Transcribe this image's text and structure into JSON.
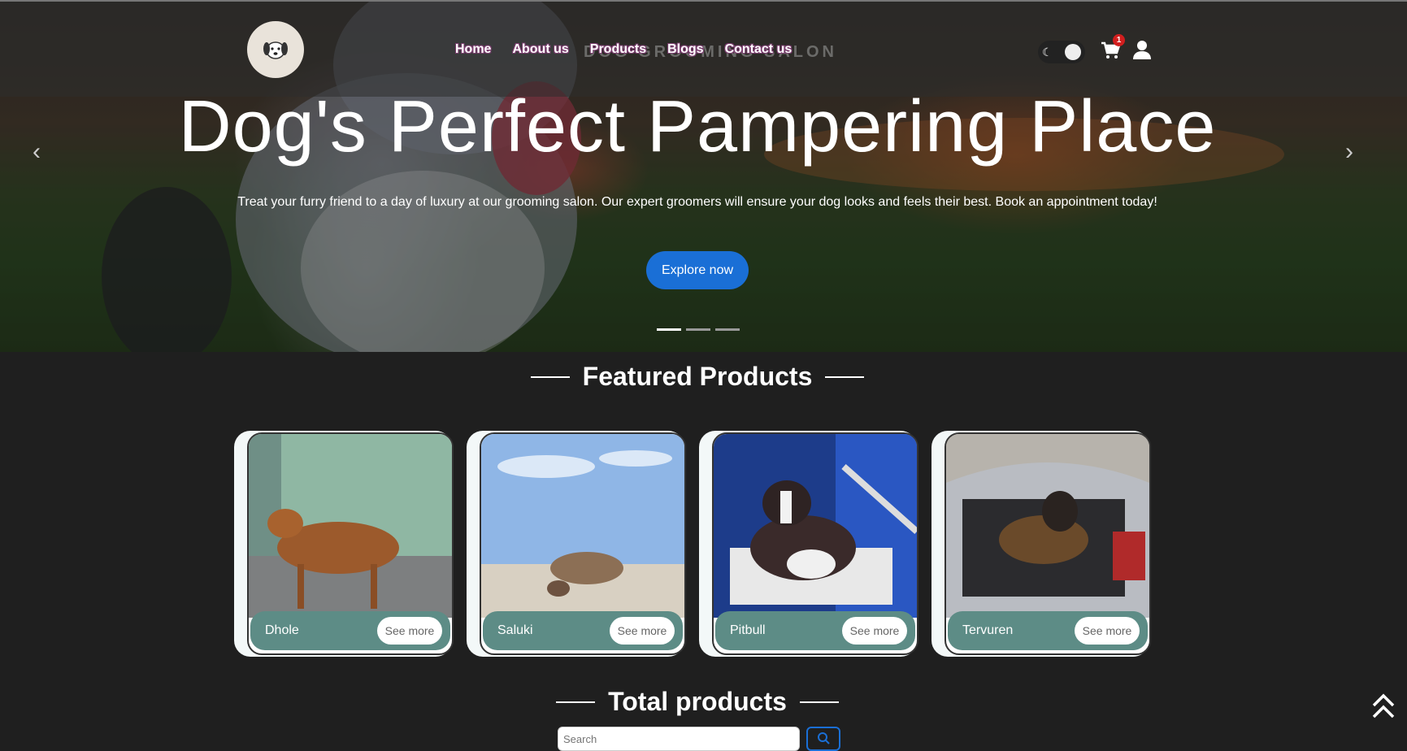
{
  "nav": {
    "items": [
      "Home",
      "About us",
      "Products",
      "Blogs",
      "Contact us"
    ],
    "watermark": "DOG GROOMING SALON",
    "cart_count": "1"
  },
  "hero": {
    "title": "Dog's Perfect Pampering Place",
    "subtitle": "Treat your furry friend to a day of luxury at our grooming salon. Our expert groomers will ensure your dog looks and feels their best. Book an appointment today!",
    "cta": "Explore now",
    "slides": 3,
    "active_slide": 1
  },
  "featured": {
    "title": "Featured Products",
    "products": [
      {
        "name": "Dhole",
        "button": "See more"
      },
      {
        "name": "Saluki",
        "button": "See more"
      },
      {
        "name": "Pitbull",
        "button": "See more"
      },
      {
        "name": "Tervuren",
        "button": "See more"
      }
    ]
  },
  "total": {
    "title": "Total products",
    "search_placeholder": "Search"
  },
  "colors": {
    "accent": "#1a6fd6",
    "card_footer": "#5d8c86",
    "badge": "#d21e1e",
    "background": "#1f1f1f"
  },
  "icons": [
    "dog-logo-icon",
    "moon-icon",
    "cart-icon",
    "user-icon",
    "chevron-left-icon",
    "chevron-right-icon",
    "search-icon",
    "double-chevron-up-icon"
  ]
}
